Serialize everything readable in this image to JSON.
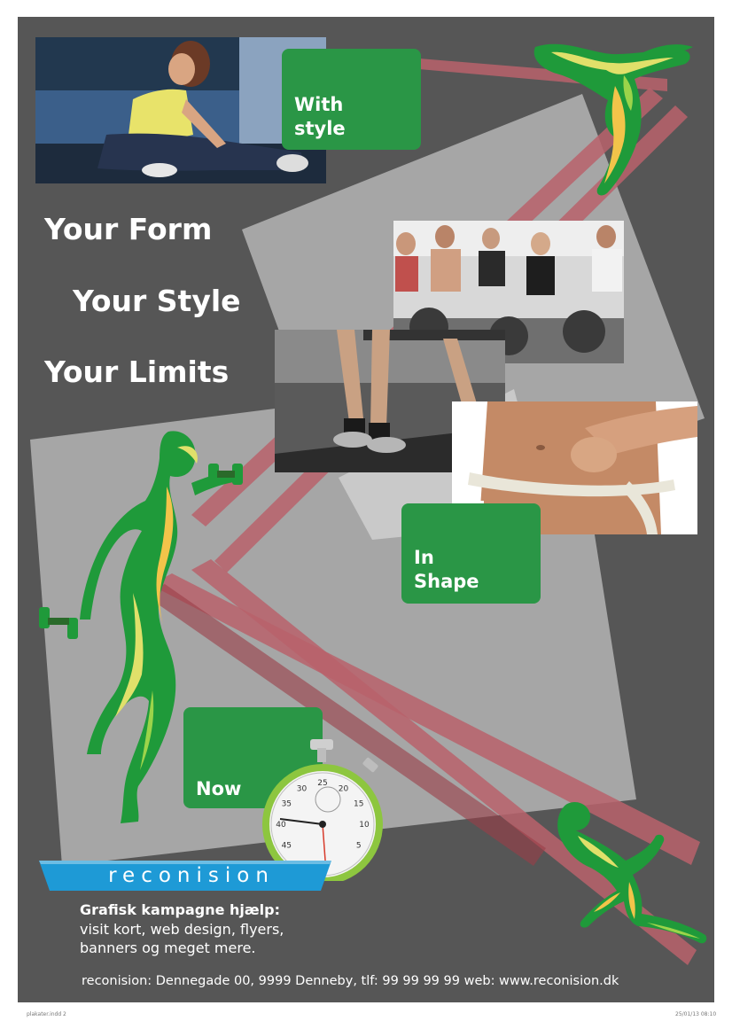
{
  "headlines": {
    "line1": "Your Form",
    "line2": "Your Style",
    "line3": "Your Limits"
  },
  "callouts": {
    "with_style": "With\nstyle",
    "in_shape": "In\nShape",
    "now": "Now"
  },
  "brand": {
    "name": "reconision"
  },
  "services": {
    "title": "Grafisk kampagne hjælp:",
    "line1": "visit kort, web design, flyers,",
    "line2": "banners og meget mere."
  },
  "footer": {
    "contact": "reconision: Dennegade 00, 9999 Denneby, tlf: 99 99 99 99 web: www.reconision.dk"
  },
  "print_meta": {
    "file": "plakater.indd  2",
    "timestamp": "25/01/13   08:10"
  },
  "stopwatch_numbers": [
    "45",
    "40",
    "35",
    "30",
    "25",
    "20",
    "15",
    "10",
    "5"
  ],
  "colors": {
    "poster_background": "#565656",
    "panel_gray": "#a6a6a6",
    "stripe_red": "#b9626b",
    "callout_green": "#2a9646",
    "banner_blue": "#1e9ad6",
    "text": "#ffffff"
  },
  "icons": [
    "dumbbell-athlete-icon",
    "dancer-figure-icon",
    "runner-figure-icon",
    "stopwatch-icon"
  ]
}
